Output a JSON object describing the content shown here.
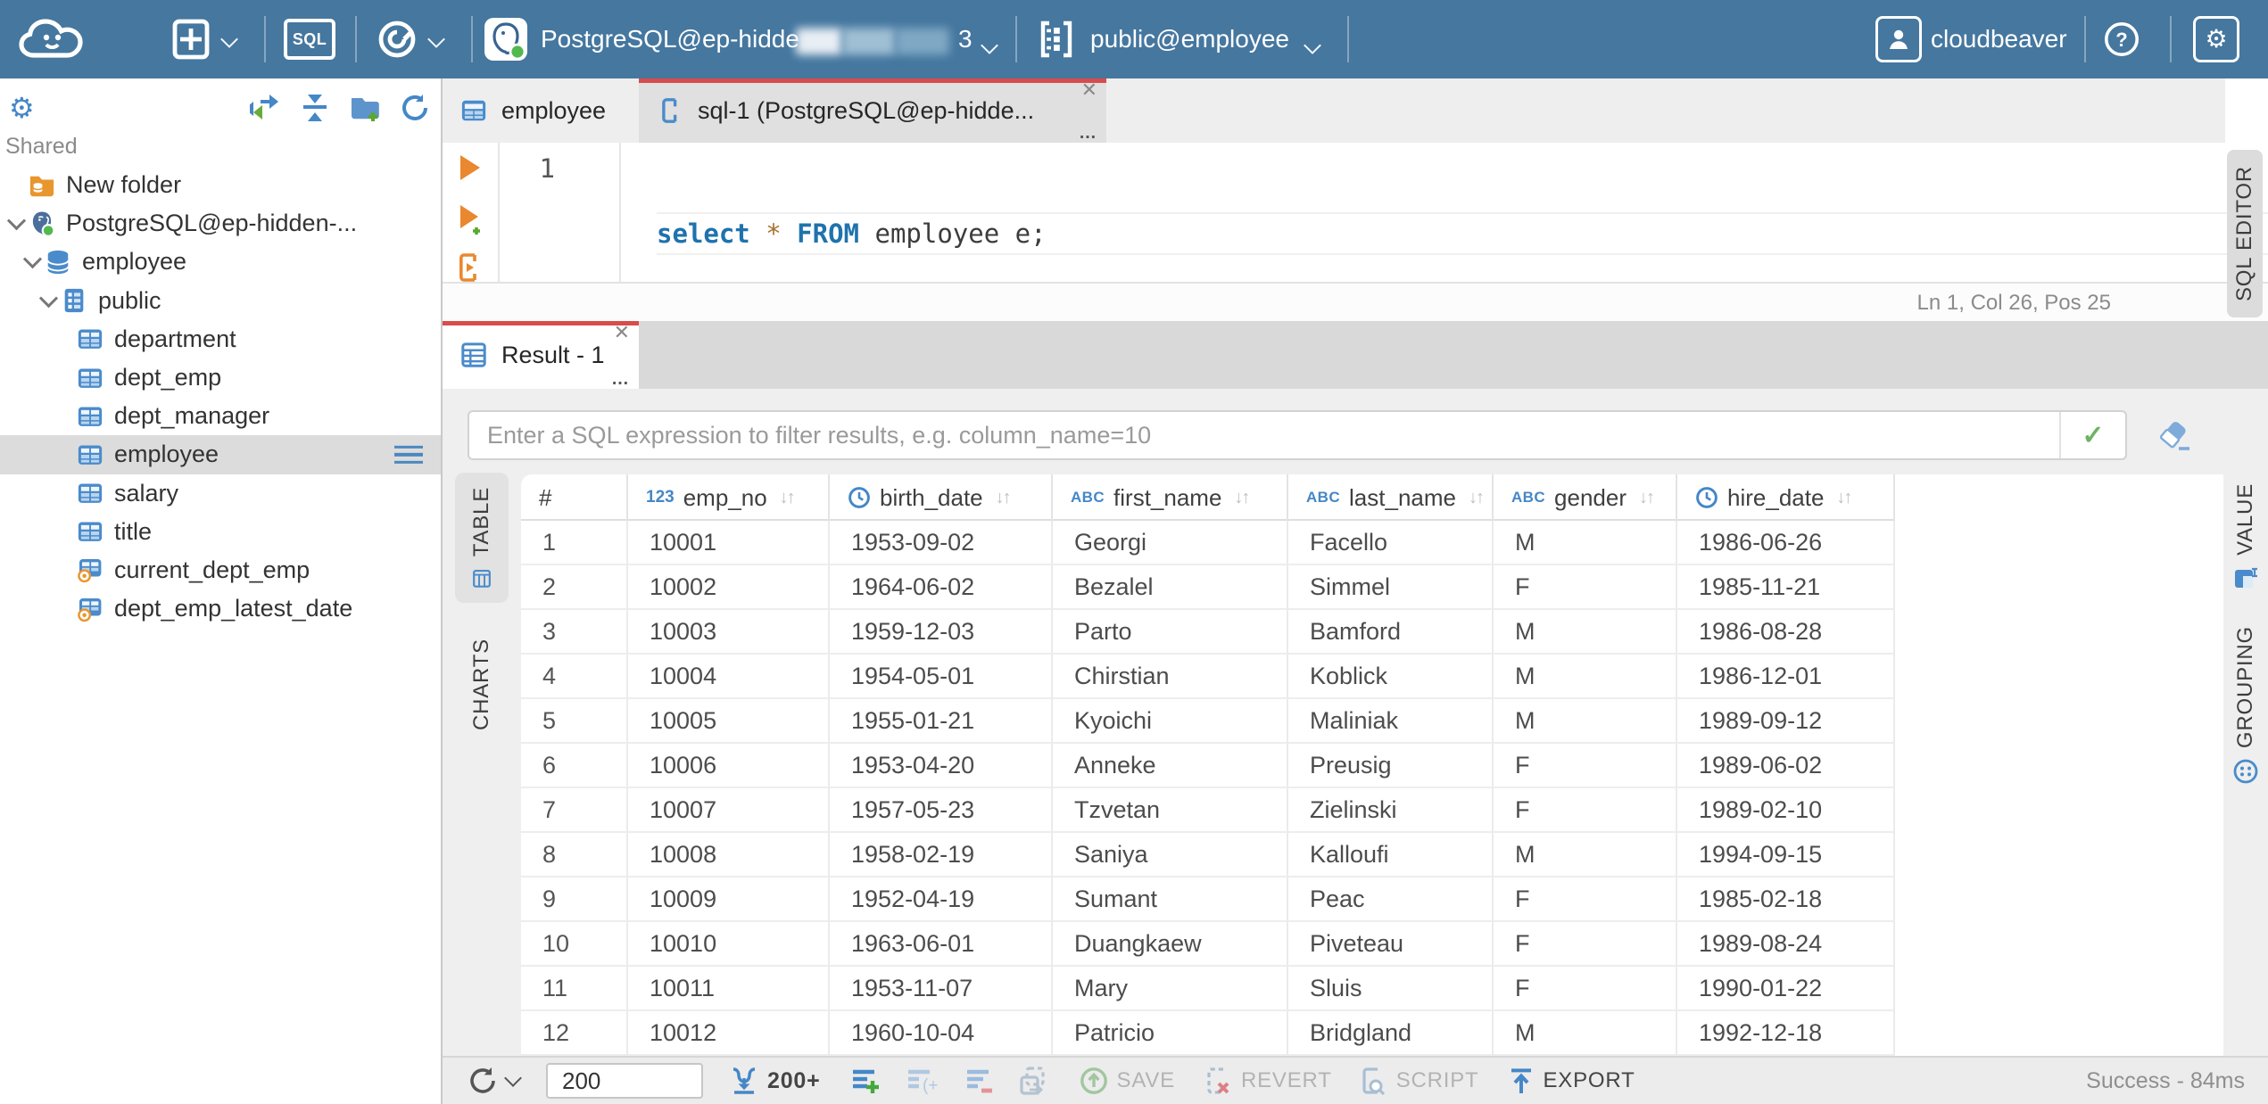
{
  "topbar": {
    "sql_badge": "SQL",
    "connection_name": "PostgreSQL@ep-hidde",
    "connection_tail": "3",
    "schema_selector": "public@employee",
    "username": "cloudbeaver"
  },
  "sidebar": {
    "section_label": "Shared",
    "items": [
      {
        "label": "New folder",
        "icon": "folder",
        "depth": 0,
        "chevron": false,
        "selected": false
      },
      {
        "label": "PostgreSQL@ep-hidden-...",
        "icon": "postgres",
        "depth": 0,
        "chevron": true,
        "selected": false
      },
      {
        "label": "employee",
        "icon": "database",
        "depth": 1,
        "chevron": true,
        "selected": false
      },
      {
        "label": "public",
        "icon": "schema",
        "depth": 2,
        "chevron": true,
        "selected": false
      },
      {
        "label": "department",
        "icon": "table",
        "depth": 3,
        "chevron": false,
        "selected": false
      },
      {
        "label": "dept_emp",
        "icon": "table",
        "depth": 3,
        "chevron": false,
        "selected": false
      },
      {
        "label": "dept_manager",
        "icon": "table",
        "depth": 3,
        "chevron": false,
        "selected": false
      },
      {
        "label": "employee",
        "icon": "table",
        "depth": 3,
        "chevron": false,
        "selected": true
      },
      {
        "label": "salary",
        "icon": "table",
        "depth": 3,
        "chevron": false,
        "selected": false
      },
      {
        "label": "title",
        "icon": "table",
        "depth": 3,
        "chevron": false,
        "selected": false
      },
      {
        "label": "current_dept_emp",
        "icon": "view",
        "depth": 3,
        "chevron": false,
        "selected": false
      },
      {
        "label": "dept_emp_latest_date",
        "icon": "view",
        "depth": 3,
        "chevron": false,
        "selected": false
      }
    ]
  },
  "editor_tabs": {
    "table_tab": "employee",
    "sql_tab": "sql-1 (PostgreSQL@ep-hidde..."
  },
  "editor": {
    "line_number": "1",
    "sql": {
      "kw1": "select",
      "star": "*",
      "kw2": "FROM",
      "rest": "employee e;"
    },
    "status": "Ln 1, Col 26, Pos 25"
  },
  "result": {
    "tab_label": "Result - 1",
    "filter_placeholder": "Enter a SQL expression to filter results, e.g. column_name=10",
    "side_tabs": {
      "left": [
        "TABLE",
        "CHARTS"
      ],
      "right": [
        "VALUE",
        "GROUPING"
      ],
      "editor_rail": "SQL EDITOR"
    }
  },
  "grid": {
    "index_header": "#",
    "type_badges": {
      "number": "123",
      "string": "ABC"
    },
    "columns": [
      {
        "label": "emp_no",
        "type": "number"
      },
      {
        "label": "birth_date",
        "type": "date"
      },
      {
        "label": "first_name",
        "type": "string"
      },
      {
        "label": "last_name",
        "type": "string"
      },
      {
        "label": "gender",
        "type": "string"
      },
      {
        "label": "hire_date",
        "type": "date"
      }
    ],
    "rows": [
      [
        "1",
        "10001",
        "1953-09-02",
        "Georgi",
        "Facello",
        "M",
        "1986-06-26"
      ],
      [
        "2",
        "10002",
        "1964-06-02",
        "Bezalel",
        "Simmel",
        "F",
        "1985-11-21"
      ],
      [
        "3",
        "10003",
        "1959-12-03",
        "Parto",
        "Bamford",
        "M",
        "1986-08-28"
      ],
      [
        "4",
        "10004",
        "1954-05-01",
        "Chirstian",
        "Koblick",
        "M",
        "1986-12-01"
      ],
      [
        "5",
        "10005",
        "1955-01-21",
        "Kyoichi",
        "Maliniak",
        "M",
        "1989-09-12"
      ],
      [
        "6",
        "10006",
        "1953-04-20",
        "Anneke",
        "Preusig",
        "F",
        "1989-06-02"
      ],
      [
        "7",
        "10007",
        "1957-05-23",
        "Tzvetan",
        "Zielinski",
        "F",
        "1989-02-10"
      ],
      [
        "8",
        "10008",
        "1958-02-19",
        "Saniya",
        "Kalloufi",
        "M",
        "1994-09-15"
      ],
      [
        "9",
        "10009",
        "1952-04-19",
        "Sumant",
        "Peac",
        "F",
        "1985-02-18"
      ],
      [
        "10",
        "10010",
        "1963-06-01",
        "Duangkaew",
        "Piveteau",
        "F",
        "1989-08-24"
      ],
      [
        "11",
        "10011",
        "1953-11-07",
        "Mary",
        "Sluis",
        "F",
        "1990-01-22"
      ],
      [
        "12",
        "10012",
        "1960-10-04",
        "Patricio",
        "Bridgland",
        "M",
        "1992-12-18"
      ]
    ]
  },
  "footer": {
    "limit_value": "200",
    "fetch_label": "200+",
    "save_label": "SAVE",
    "revert_label": "REVERT",
    "script_label": "SCRIPT",
    "export_label": "EXPORT",
    "status": "Success - 84ms"
  },
  "colors": {
    "topbar_blue": "#45779f",
    "accent_red": "#d94c4c",
    "icon_blue": "#4587c7",
    "icon_orange": "#e9882e",
    "icon_green": "#58a94a"
  }
}
